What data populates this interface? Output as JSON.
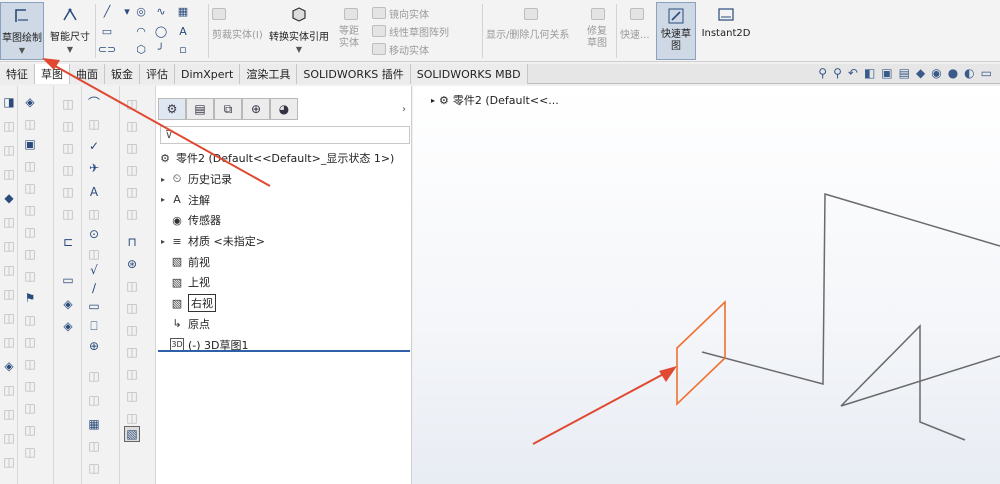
{
  "ribbon": {
    "sketch_label": "草图绘制",
    "smart_dim_label": "智能尺寸",
    "trim_label": "剪裁实体(I)",
    "convert_label": "转换实体引用",
    "offset_label": "等距实体",
    "mirror_label": "镜向实体",
    "linear_pattern_label": "线性草图阵列",
    "move_label": "移动实体",
    "relations_label": "显示/删除几何关系",
    "repair_label": "修复草图",
    "quick_snaps_label": "快速...",
    "rapid_sketch_label": "快速草图",
    "instant2d_label": "Instant2D"
  },
  "tabs": [
    {
      "label": "特征",
      "active": false
    },
    {
      "label": "草图",
      "active": true
    },
    {
      "label": "曲面",
      "active": false
    },
    {
      "label": "钣金",
      "active": false
    },
    {
      "label": "评估",
      "active": false
    },
    {
      "label": "DimXpert",
      "active": false
    },
    {
      "label": "渲染工具",
      "active": false
    },
    {
      "label": "SOLIDWORKS 插件",
      "active": false
    },
    {
      "label": "SOLIDWORKS MBD",
      "active": false
    }
  ],
  "tree": {
    "root": "零件2  (Default<<Default>_显示状态 1>)",
    "items": [
      {
        "label": "历史记录",
        "expandable": true,
        "icon": "history-icon"
      },
      {
        "label": "注解",
        "expandable": true,
        "icon": "annotation-icon"
      },
      {
        "label": "传感器",
        "expandable": false,
        "icon": "sensor-icon"
      },
      {
        "label": "材质 <未指定>",
        "expandable": true,
        "icon": "material-icon"
      },
      {
        "label": "前视",
        "expandable": false,
        "icon": "plane-icon"
      },
      {
        "label": "上视",
        "expandable": false,
        "icon": "plane-icon"
      },
      {
        "label": "右视",
        "expandable": false,
        "icon": "plane-icon"
      },
      {
        "label": "原点",
        "expandable": false,
        "icon": "origin-icon"
      },
      {
        "label": "(-) 3D草图1",
        "expandable": false,
        "icon": "3d-sketch-icon"
      }
    ]
  },
  "graphics": {
    "tree_label": "零件2  (Default<<..."
  },
  "colors": {
    "highlight_plane": "#f07030",
    "arrow": "#e04a32",
    "sketch_line": "#6a6a6a",
    "active_tab": "#ffffff",
    "selection": "#cfd9e6"
  }
}
